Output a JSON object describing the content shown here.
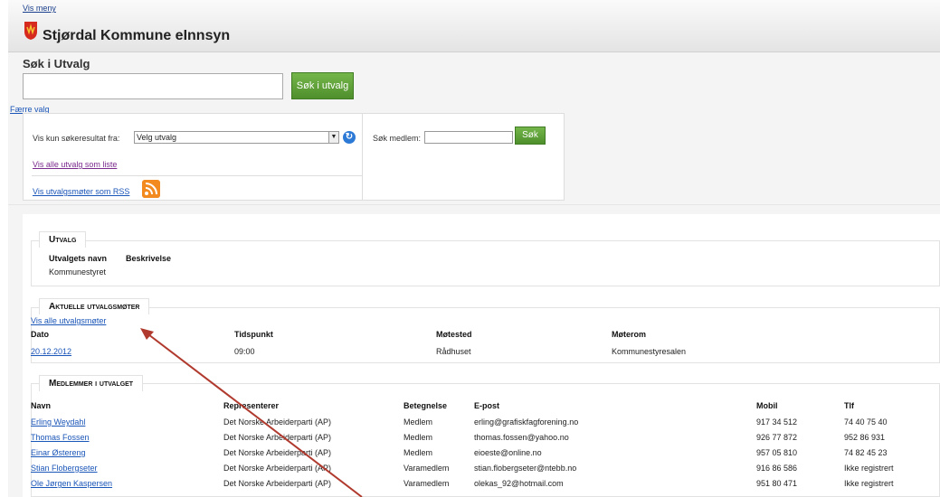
{
  "header": {
    "vis_meny": "Vis meny",
    "title": "Stjørdal Kommune eInnsyn"
  },
  "search": {
    "title": "Søk i Utvalg",
    "input_value": "",
    "button": "Søk i utvalg",
    "faerre_valg": "Færre valg"
  },
  "options": {
    "vis_kun_label": "Vis kun søkeresultat fra:",
    "select_value": "Velg utvalg",
    "vis_alle_liste": "Vis alle utvalg som liste",
    "rss_link": "Vis utvalgsmøter som RSS",
    "medlem_label": "Søk medlem:",
    "medlem_value": "",
    "sok_button": "Søk"
  },
  "utvalg": {
    "tab": "Utvalg",
    "headers": [
      "Utvalgets navn",
      "Beskrivelse"
    ],
    "name": "Kommunestyret"
  },
  "moter": {
    "tab": "Aktuelle utvalgsmøter",
    "vis_alle": "Vis alle utvalgsmøter",
    "headers": [
      "Dato",
      "Tidspunkt",
      "Møtested",
      "Møterom"
    ],
    "row": [
      "20.12.2012",
      "09:00",
      "Rådhuset",
      "Kommunestyresalen"
    ]
  },
  "medlemmer": {
    "tab": "Medlemmer i utvalget",
    "headers": [
      "Navn",
      "Representerer",
      "Betegnelse",
      "E-post",
      "Mobil",
      "Tlf"
    ],
    "rows": [
      [
        "Erling Weydahl",
        "Det Norske Arbeiderparti (AP)",
        "Medlem",
        "erling@grafiskfagforening.no",
        "917 34 512",
        "74 40 75 40"
      ],
      [
        "Thomas Fossen",
        "Det Norske Arbeiderparti (AP)",
        "Medlem",
        "thomas.fossen@yahoo.no",
        "926 77 872",
        "952 86 931"
      ],
      [
        "Einar Østereng",
        "Det Norske Arbeiderparti (AP)",
        "Medlem",
        "eioeste@online.no",
        "957 05 810",
        "74 82 45 23"
      ],
      [
        "Stian Flobergseter",
        "Det Norske Arbeiderparti (AP)",
        "Varamedlem",
        "stian.flobergseter@ntebb.no",
        "916 86 586",
        "Ikke registrert"
      ],
      [
        "Ole Jørgen Kaspersen",
        "Det Norske Arbeiderparti (AP)",
        "Varamedlem",
        "olekas_92@hotmail.com",
        "951 80 471",
        "Ikke registrert"
      ]
    ]
  },
  "colors": {
    "accent": "#1a55b8",
    "button_green": "#5c9e35",
    "arrow": "#b03a2e"
  },
  "icons": [
    "shield-logo-icon",
    "refresh-icon",
    "rss-icon",
    "select-arrow-icon"
  ]
}
